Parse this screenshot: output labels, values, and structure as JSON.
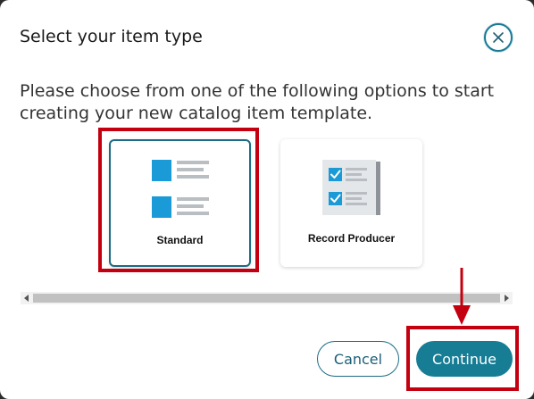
{
  "dialog": {
    "title": "Select your item type",
    "close_icon": "close-icon",
    "instructions": "Please choose from one of the following options to start creating your new catalog item template."
  },
  "options": [
    {
      "label": "Standard",
      "icon": "standard-layout-icon",
      "selected": true
    },
    {
      "label": "Record Producer",
      "icon": "checklist-form-icon",
      "selected": false
    }
  ],
  "scrollbar": {
    "left_icon": "scroll-left-arrow-icon",
    "right_icon": "scroll-right-arrow-icon"
  },
  "footer": {
    "cancel_label": "Cancel",
    "continue_label": "Continue"
  },
  "annotations": {
    "highlight_color": "#c40010",
    "arrow_icon": "down-arrow-icon"
  },
  "colors": {
    "accent": "#167d95",
    "icon_blue": "#1a9ad6",
    "icon_gray": "#b9bec3"
  }
}
